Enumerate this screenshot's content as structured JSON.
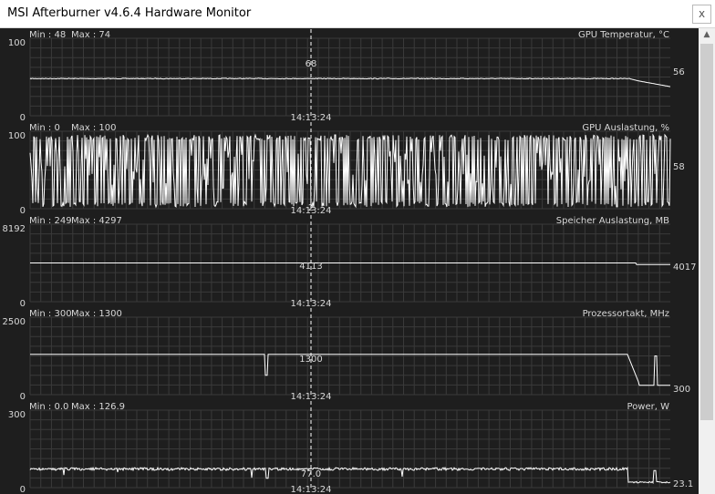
{
  "window": {
    "title": "MSI Afterburner v4.6.4 Hardware Monitor",
    "close_glyph": "x"
  },
  "colors": {
    "background": "#1e1e1e",
    "grid": "#3a3a3a",
    "trace": "#ffffff",
    "text": "#d8d8d8"
  },
  "cursor_time": "14:13:24",
  "graphs": [
    {
      "title": "GPU Temperatur, °C",
      "min_label": "Min : 48",
      "max_label": "Max : 74",
      "y_top": "100",
      "y_bottom": "0",
      "cursor_value": "68",
      "current_value": "56"
    },
    {
      "title": "GPU Auslastung, %",
      "min_label": "Min : 0",
      "max_label": "Max : 100",
      "y_top": "100",
      "y_bottom": "0",
      "cursor_value": "2",
      "current_value": "58"
    },
    {
      "title": "Speicher Auslastung, MB",
      "min_label": "Min : 249",
      "max_label": "Max : 4297",
      "y_top": "8192",
      "y_bottom": "0",
      "cursor_value": "4113",
      "current_value": "4017"
    },
    {
      "title": "Prozessortakt, MHz",
      "min_label": "Min : 300",
      "max_label": "Max : 1300",
      "y_top": "2500",
      "y_bottom": "0",
      "cursor_value": "1300",
      "current_value": "300"
    },
    {
      "title": "Power, W",
      "min_label": "Min : 0.0",
      "max_label": "Max : 126.9",
      "y_top": "300",
      "y_bottom": "0",
      "cursor_value": "77.0",
      "current_value": "23.1"
    }
  ]
}
